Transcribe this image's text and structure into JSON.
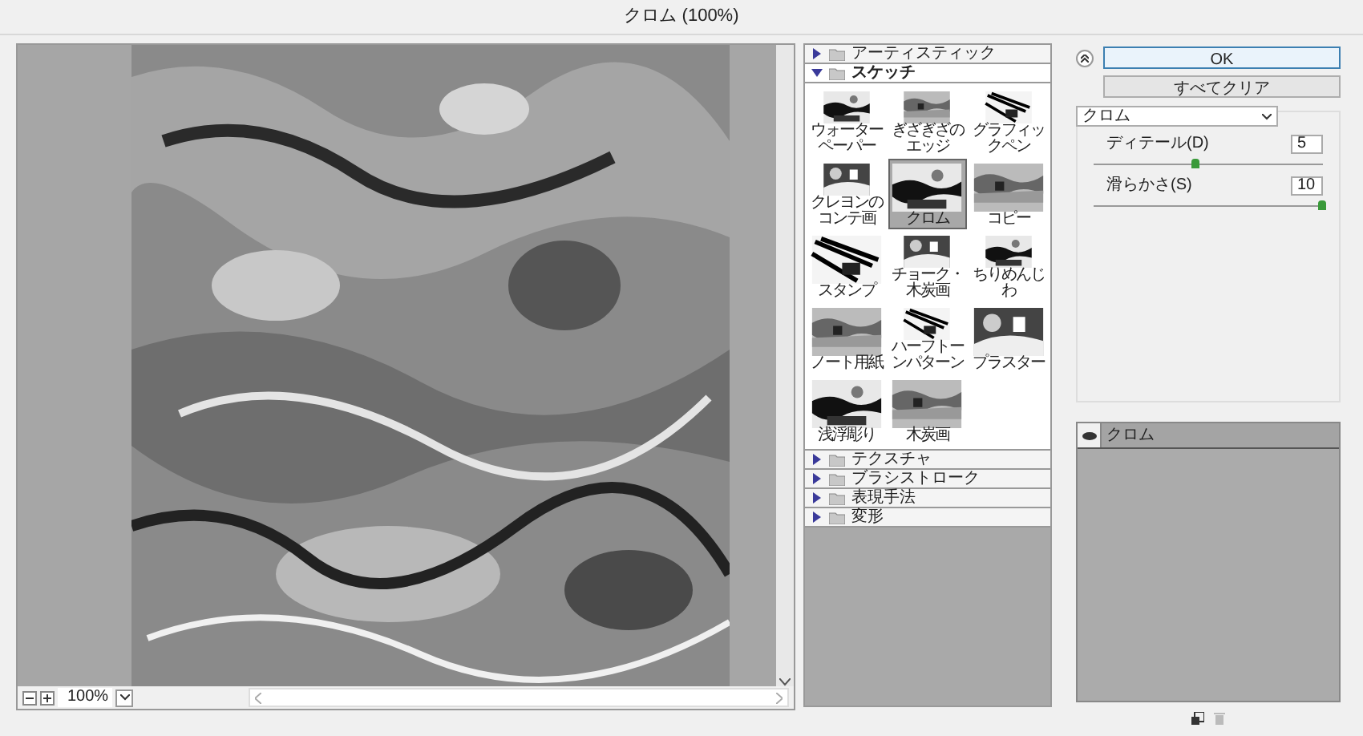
{
  "window": {
    "title": "クロム (100%)"
  },
  "preview": {
    "zoom": "100%"
  },
  "categories": [
    {
      "label": "アーティスティック",
      "expanded": false
    },
    {
      "label": "スケッチ",
      "expanded": true,
      "filters": [
        {
          "label": "ウォーターペーパー",
          "selected": false
        },
        {
          "label": "ぎざぎざのエッジ",
          "selected": false
        },
        {
          "label": "グラフィックペン",
          "selected": false
        },
        {
          "label": "クレヨンのコンテ画",
          "selected": false
        },
        {
          "label": "クロム",
          "selected": true
        },
        {
          "label": "コピー",
          "selected": false
        },
        {
          "label": "スタンプ",
          "selected": false
        },
        {
          "label": "チョーク・木炭画",
          "selected": false
        },
        {
          "label": "ちりめんじわ",
          "selected": false
        },
        {
          "label": "ノート用紙",
          "selected": false
        },
        {
          "label": "ハーフトーンパターン",
          "selected": false
        },
        {
          "label": "プラスター",
          "selected": false
        },
        {
          "label": "浅浮彫り",
          "selected": false
        },
        {
          "label": "木炭画",
          "selected": false
        }
      ]
    },
    {
      "label": "テクスチャ",
      "expanded": false
    },
    {
      "label": "ブラシストローク",
      "expanded": false
    },
    {
      "label": "表現手法",
      "expanded": false
    },
    {
      "label": "変形",
      "expanded": false
    }
  ],
  "settings": {
    "ok": "OK",
    "clear": "すべてクリア",
    "filter": "クロム",
    "params": [
      {
        "label": "ディテール(D)",
        "value": "5",
        "level": 0.45
      },
      {
        "label": "滑らかさ(S)",
        "value": "10",
        "level": 1
      }
    ]
  },
  "layers": [
    {
      "label": "クロム",
      "visible": true
    }
  ]
}
